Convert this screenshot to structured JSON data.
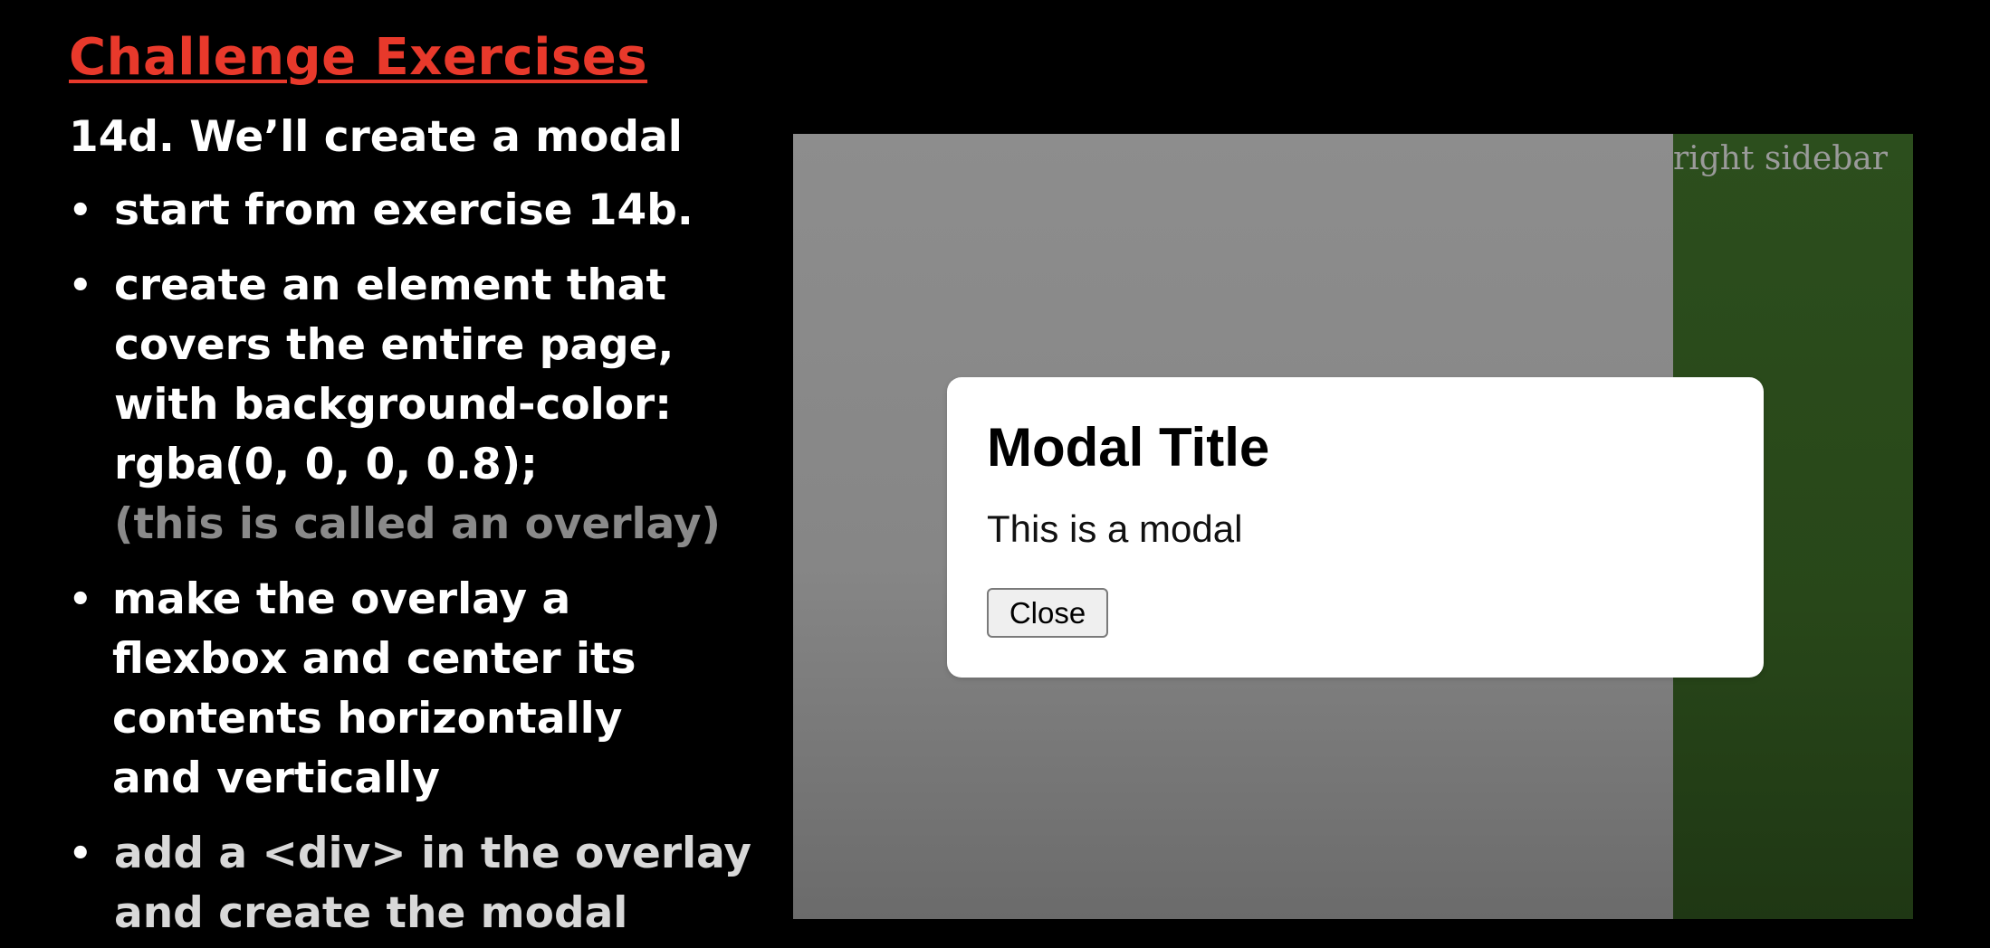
{
  "slide": {
    "title": "Challenge Exercises",
    "subtitle": "14d. We’ll create a modal",
    "bullets": [
      {
        "lines": [
          "start from exercise 14b."
        ]
      },
      {
        "lines": [
          "create an element that",
          "covers the entire page,",
          "with background-color:",
          "rgba(0, 0, 0, 0.8);",
          "(this is called an overlay)"
        ]
      },
      {
        "lines": [
          "make the overlay a",
          "flexbox and center its",
          "contents horizontally",
          "and vertically"
        ]
      },
      {
        "lines": [
          "add a <div> in the overlay",
          "and create the modal"
        ]
      }
    ],
    "bullet_symbol": "•"
  },
  "demo": {
    "sidebar_label": "right sidebar",
    "modal": {
      "title": "Modal Title",
      "text": "This is a modal",
      "close_label": "Close"
    }
  },
  "colors": {
    "title": "#e8392b",
    "overlay_gray": "#8d8d8d",
    "sidebar_green": "#2c4e1d",
    "modal_bg": "#ffffff"
  }
}
